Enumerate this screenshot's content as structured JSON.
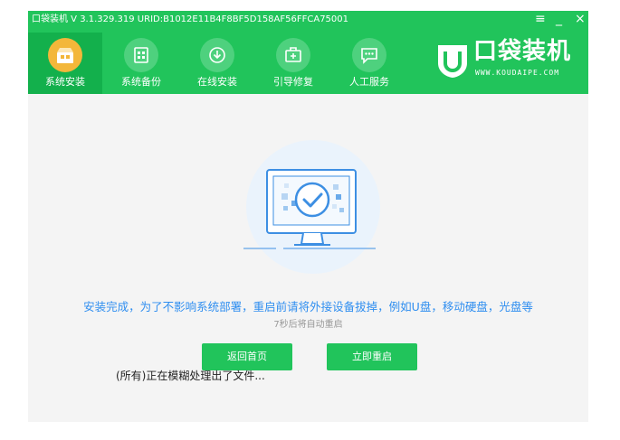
{
  "window": {
    "title": "口袋装机 V 3.1.329.319 URID:B1012E11B4F8BF5D158AF56FFCA75001",
    "controls": {
      "menu": "≡",
      "minimize": "_",
      "close": "×"
    }
  },
  "nav": {
    "items": [
      {
        "label": "系统安装",
        "icon": "system-install-icon",
        "active": true
      },
      {
        "label": "系统备份",
        "icon": "system-backup-icon",
        "active": false
      },
      {
        "label": "在线安装",
        "icon": "online-install-icon",
        "active": false
      },
      {
        "label": "引导修复",
        "icon": "boot-repair-icon",
        "active": false
      },
      {
        "label": "人工服务",
        "icon": "chat-service-icon",
        "active": false
      }
    ]
  },
  "brand": {
    "name": "口袋装机",
    "url": "WWW.KOUDAIPE.COM"
  },
  "main": {
    "message": "安装完成，为了不影响系统部署，重启前请将外接设备拔掉，例如U盘，移动硬盘，光盘等",
    "countdown": "7秒后将自动重启",
    "home_button": "返回首页",
    "restart_button": "立即重启",
    "status_overlay": "(所有)正在模糊处理出了文件..."
  },
  "colors": {
    "header_green": "#21c45b",
    "active_tab": "#13b04c",
    "accent_blue": "#2f8ef0",
    "button_green": "#21c45b"
  }
}
